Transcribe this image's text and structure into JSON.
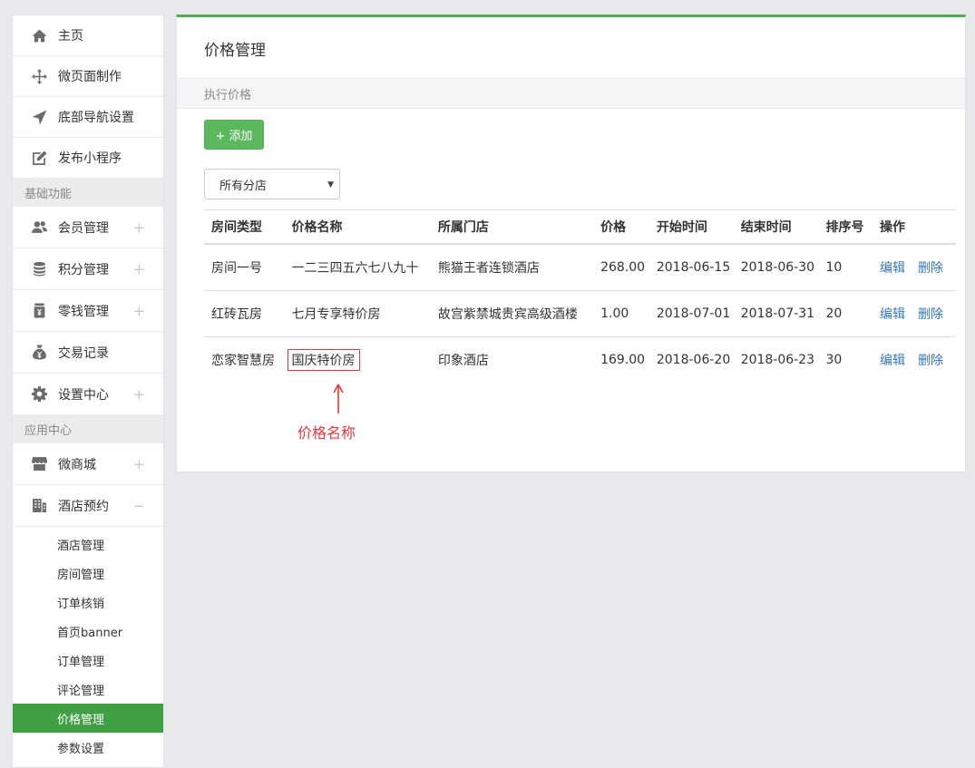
{
  "sidebar": {
    "top_items": [
      {
        "label": "主页",
        "icon": "home-icon"
      },
      {
        "label": "微页面制作",
        "icon": "move-arrows-icon"
      },
      {
        "label": "底部导航设置",
        "icon": "navigation-arrow-icon"
      },
      {
        "label": "发布小程序",
        "icon": "edit-square-icon"
      }
    ],
    "section_basic": "基础功能",
    "basic_items": [
      {
        "label": "会员管理",
        "icon": "users-icon",
        "toggle": "+"
      },
      {
        "label": "积分管理",
        "icon": "coins-stack-icon",
        "toggle": "+"
      },
      {
        "label": "零钱管理",
        "icon": "money-jar-icon",
        "toggle": "+"
      },
      {
        "label": "交易记录",
        "icon": "money-bag-icon"
      },
      {
        "label": "设置中心",
        "icon": "gear-icon",
        "toggle": "+"
      }
    ],
    "section_apps": "应用中心",
    "app_items": [
      {
        "label": "微商城",
        "icon": "storefront-icon",
        "toggle": "+"
      },
      {
        "label": "酒店预约",
        "icon": "building-icon",
        "toggle": "−"
      }
    ],
    "hotel_sub_items": [
      "酒店管理",
      "房间管理",
      "订单核销",
      "首页banner",
      "订单管理",
      "评论管理",
      "价格管理",
      "参数设置"
    ],
    "active_sub_item": "价格管理"
  },
  "main": {
    "title": "价格管理",
    "subheader": "执行价格",
    "add_button": "+ 添加",
    "store_select": {
      "selected": "所有分店"
    },
    "table": {
      "headers": [
        "房间类型",
        "价格名称",
        "所属门店",
        "价格",
        "开始时间",
        "结束时间",
        "排序号",
        "操作"
      ],
      "rows": [
        {
          "room_type": "房间一号",
          "price_name": "一二三四五六七八九十",
          "store": "熊猫王者连锁酒店",
          "price": "268.00",
          "start": "2018-06-15",
          "end": "2018-06-30",
          "sort": "10",
          "edit": "编辑",
          "delete": "删除"
        },
        {
          "room_type": "红砖瓦房",
          "price_name": "七月专享特价房",
          "store": "故宫紫禁城贵宾高级酒楼",
          "price": "1.00",
          "start": "2018-07-01",
          "end": "2018-07-31",
          "sort": "20",
          "edit": "编辑",
          "delete": "删除"
        },
        {
          "room_type": "恋家智慧房",
          "price_name": "国庆特价房",
          "store": "印象酒店",
          "price": "169.00",
          "start": "2018-06-20",
          "end": "2018-06-23",
          "sort": "30",
          "edit": "编辑",
          "delete": "删除"
        }
      ]
    },
    "annotation": {
      "text": "价格名称",
      "color": "#e4393c"
    }
  },
  "colors": {
    "accent": "#4cae4f",
    "active_bg": "#41a046",
    "link": "#337ab7",
    "button": "#5cb85c"
  }
}
